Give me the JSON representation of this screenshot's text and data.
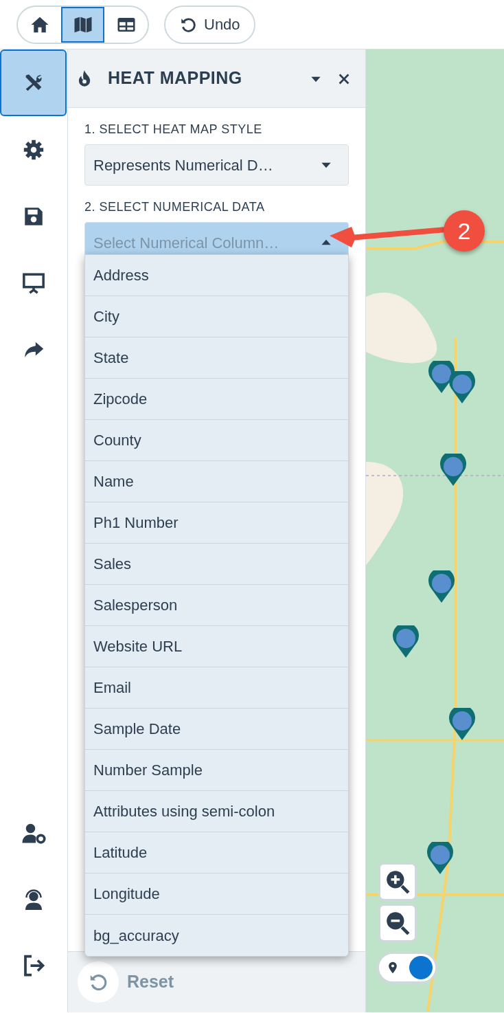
{
  "toolbar": {
    "view_buttons": [
      {
        "kind": "home",
        "selected": false
      },
      {
        "kind": "map",
        "selected": true
      },
      {
        "kind": "table",
        "selected": false
      }
    ],
    "undo": "Undo"
  },
  "sidebar": {
    "items": [
      {
        "kind": "tools",
        "selected": true
      },
      {
        "kind": "settings",
        "selected": false
      },
      {
        "kind": "save",
        "selected": false
      },
      {
        "kind": "presentation",
        "selected": false
      },
      {
        "kind": "share",
        "selected": false
      }
    ],
    "bottom_items": [
      {
        "kind": "user-settings"
      },
      {
        "kind": "support"
      },
      {
        "kind": "logout"
      }
    ]
  },
  "panel": {
    "title": "HEAT MAPPING",
    "step1": {
      "label": "1. SELECT HEAT MAP STYLE",
      "value": "Represents Numerical D…"
    },
    "step2": {
      "label": "2. SELECT NUMERICAL DATA",
      "placeholder": "Select Numerical Column…",
      "expanded": true,
      "options": [
        "Address",
        "City",
        "State",
        "Zipcode",
        "County",
        "Name",
        "Ph1 Number",
        "Sales",
        "Salesperson",
        "Website URL",
        "Email",
        "Sample Date",
        "Number Sample",
        "Attributes using semi-colon",
        "Latitude",
        "Longitude",
        "bg_accuracy"
      ]
    },
    "reset": "Reset"
  },
  "map": {
    "kind": "picture",
    "location_toggle": {
      "on": true
    }
  },
  "annotation": {
    "number": "2"
  }
}
